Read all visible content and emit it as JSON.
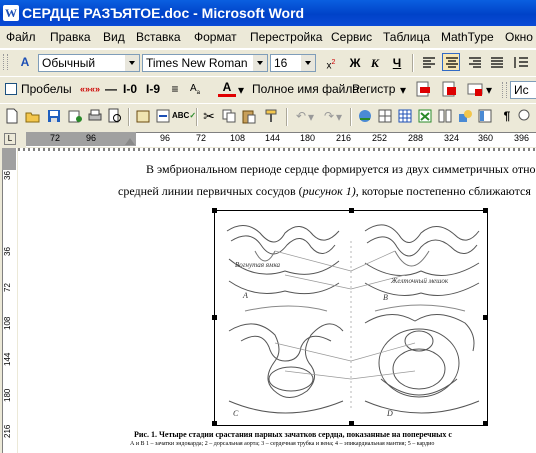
{
  "window": {
    "title": "СЕРДЦЕ РАЗЪЯТОЕ.doc - Microsoft Word"
  },
  "menu": [
    "Файл",
    "Правка",
    "Вид",
    "Вставка",
    "Формат",
    "Перестройка",
    "Сервис",
    "Таблица",
    "MathType",
    "Окно"
  ],
  "formatting": {
    "style": "Обычный",
    "font": "Times New Roman",
    "size": "16"
  },
  "toolbar2": {
    "spaces_label": "Пробелы",
    "fullname_label": "Полное имя файла",
    "case_label": "Регистр",
    "right_partial": "Ис"
  },
  "ruler": {
    "h_ticks": [
      "72",
      "96",
      "96",
      "72",
      "108",
      "144",
      "180",
      "216",
      "252",
      "288",
      "324",
      "360",
      "396"
    ],
    "v_ticks": [
      "36",
      "36",
      "72",
      "108",
      "144",
      "180",
      "216"
    ]
  },
  "document": {
    "line1": "В эмбриональном периоде сердце формируется из двух симметричных отно",
    "line2_pre": "средней линии первичных сосудов (",
    "line2_ref": "рисунок 1)",
    "line2_post": ",  которые постепенно сближаются",
    "fig_labels": [
      "Вогнутая ямка",
      "Желточный мешок",
      "A",
      "B",
      "C",
      "D"
    ],
    "caption1": "Рис. 1. Четыре стадии срастания парных зачатков сердца, показанные на поперечных с",
    "caption2": "А и В 1 – зачатки эндокарда; 2 – дорсальная аорта; 3 – сердечная трубка и вена; 4 – эпикардиальная мантия; 5 – кардио"
  }
}
